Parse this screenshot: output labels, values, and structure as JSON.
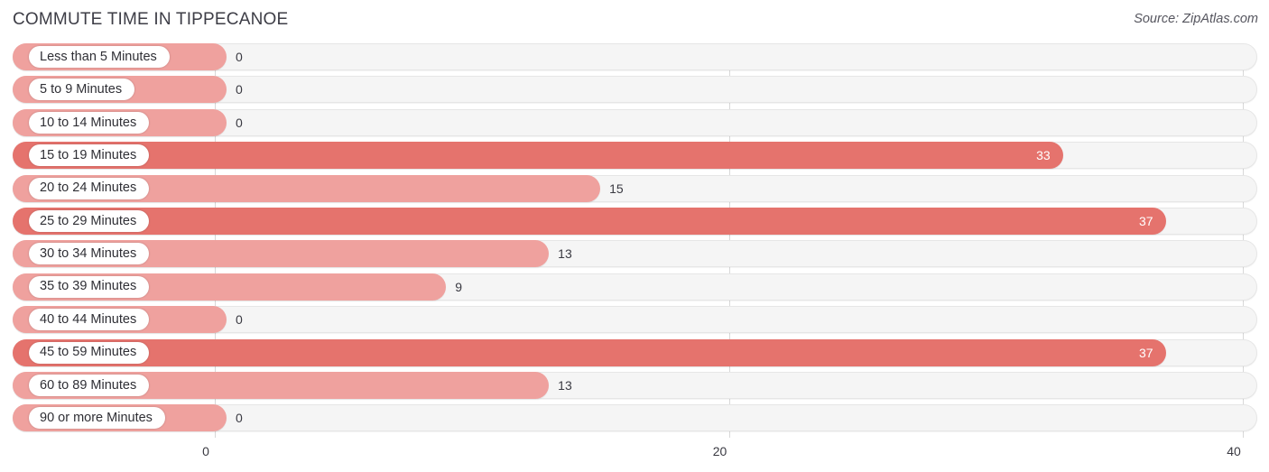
{
  "header": {
    "title": "COMMUTE TIME IN TIPPECANOE",
    "source": "Source: ZipAtlas.com"
  },
  "colors": {
    "bar_light": "#efa19e",
    "bar_dark": "#e5736d",
    "track": "#f5f5f5",
    "gridline": "#d8d8d8",
    "title_text": "#3d3d46"
  },
  "chart_data": {
    "type": "bar",
    "orientation": "horizontal",
    "title": "COMMUTE TIME IN TIPPECANOE",
    "xlabel": "",
    "ylabel": "",
    "xlim": [
      0,
      40
    ],
    "grid": true,
    "legend": null,
    "ticks": [
      {
        "label": "0",
        "value": 0
      },
      {
        "label": "20",
        "value": 20
      },
      {
        "label": "40",
        "value": 40
      }
    ],
    "categories": [
      "Less than 5 Minutes",
      "5 to 9 Minutes",
      "10 to 14 Minutes",
      "15 to 19 Minutes",
      "20 to 24 Minutes",
      "25 to 29 Minutes",
      "30 to 34 Minutes",
      "35 to 39 Minutes",
      "40 to 44 Minutes",
      "45 to 59 Minutes",
      "60 to 89 Minutes",
      "90 or more Minutes"
    ],
    "values": [
      0,
      0,
      0,
      33,
      15,
      37,
      13,
      9,
      0,
      37,
      13,
      0
    ],
    "value_labels": [
      "0",
      "0",
      "0",
      "33",
      "15",
      "37",
      "13",
      "9",
      "0",
      "37",
      "13",
      "0"
    ]
  },
  "rows": [
    {
      "label": "Less than 5 Minutes",
      "value": 0,
      "value_label": "0",
      "shade": "light",
      "label_inside": false
    },
    {
      "label": "5 to 9 Minutes",
      "value": 0,
      "value_label": "0",
      "shade": "light",
      "label_inside": false
    },
    {
      "label": "10 to 14 Minutes",
      "value": 0,
      "value_label": "0",
      "shade": "light",
      "label_inside": false
    },
    {
      "label": "15 to 19 Minutes",
      "value": 33,
      "value_label": "33",
      "shade": "dark",
      "label_inside": true
    },
    {
      "label": "20 to 24 Minutes",
      "value": 15,
      "value_label": "15",
      "shade": "light",
      "label_inside": false
    },
    {
      "label": "25 to 29 Minutes",
      "value": 37,
      "value_label": "37",
      "shade": "dark",
      "label_inside": true
    },
    {
      "label": "30 to 34 Minutes",
      "value": 13,
      "value_label": "13",
      "shade": "light",
      "label_inside": false
    },
    {
      "label": "35 to 39 Minutes",
      "value": 9,
      "value_label": "9",
      "shade": "light",
      "label_inside": false
    },
    {
      "label": "40 to 44 Minutes",
      "value": 0,
      "value_label": "0",
      "shade": "light",
      "label_inside": false
    },
    {
      "label": "45 to 59 Minutes",
      "value": 37,
      "value_label": "37",
      "shade": "dark",
      "label_inside": true
    },
    {
      "label": "60 to 89 Minutes",
      "value": 13,
      "value_label": "13",
      "shade": "light",
      "label_inside": false
    },
    {
      "label": "90 or more Minutes",
      "value": 0,
      "value_label": "0",
      "shade": "light",
      "label_inside": false
    }
  ]
}
